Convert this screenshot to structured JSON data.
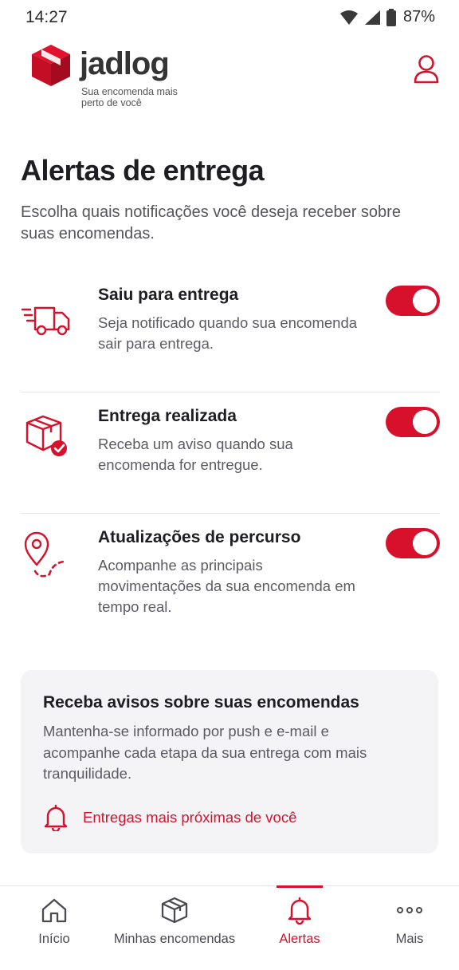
{
  "status_bar": {
    "time": "14:27",
    "battery": "87%"
  },
  "header": {
    "brand": "jadlog",
    "tagline": "Sua encomenda mais perto de você"
  },
  "page": {
    "title": "Alertas de entrega",
    "subtitle": "Escolha quais notificações você deseja receber sobre suas encomendas."
  },
  "alerts": [
    {
      "icon": "delivery-truck-icon",
      "title": "Saiu para entrega",
      "description": "Seja notificado quando sua encomenda sair para entrega.",
      "enabled": true
    },
    {
      "icon": "package-check-icon",
      "title": "Entrega realizada",
      "description": "Receba um aviso quando sua encomenda for entregue.",
      "enabled": true
    },
    {
      "icon": "route-pin-icon",
      "title": "Atualizações de percurso",
      "description": "Acompanhe as principais movimentações da sua encomenda em tempo real.",
      "enabled": true
    }
  ],
  "info_card": {
    "title": "Receba avisos sobre suas encomendas",
    "description": "Mantenha-se informado por push e e-mail e acompanhe cada etapa da sua entrega com mais tranquilidade.",
    "link_label": "Entregas mais próximas de você"
  },
  "bottom_nav": {
    "items": [
      {
        "label": "Início",
        "icon": "home-icon",
        "active": false
      },
      {
        "label": "Minhas encomendas",
        "icon": "package-icon",
        "active": false
      },
      {
        "label": "Alertas",
        "icon": "bell-icon",
        "active": true
      },
      {
        "label": "Mais",
        "icon": "more-dots-icon",
        "active": false
      }
    ]
  },
  "colors": {
    "accent": "#d7112c",
    "text": "#1d1d22",
    "muted": "#5b5b63",
    "card": "#f4f4f6"
  }
}
